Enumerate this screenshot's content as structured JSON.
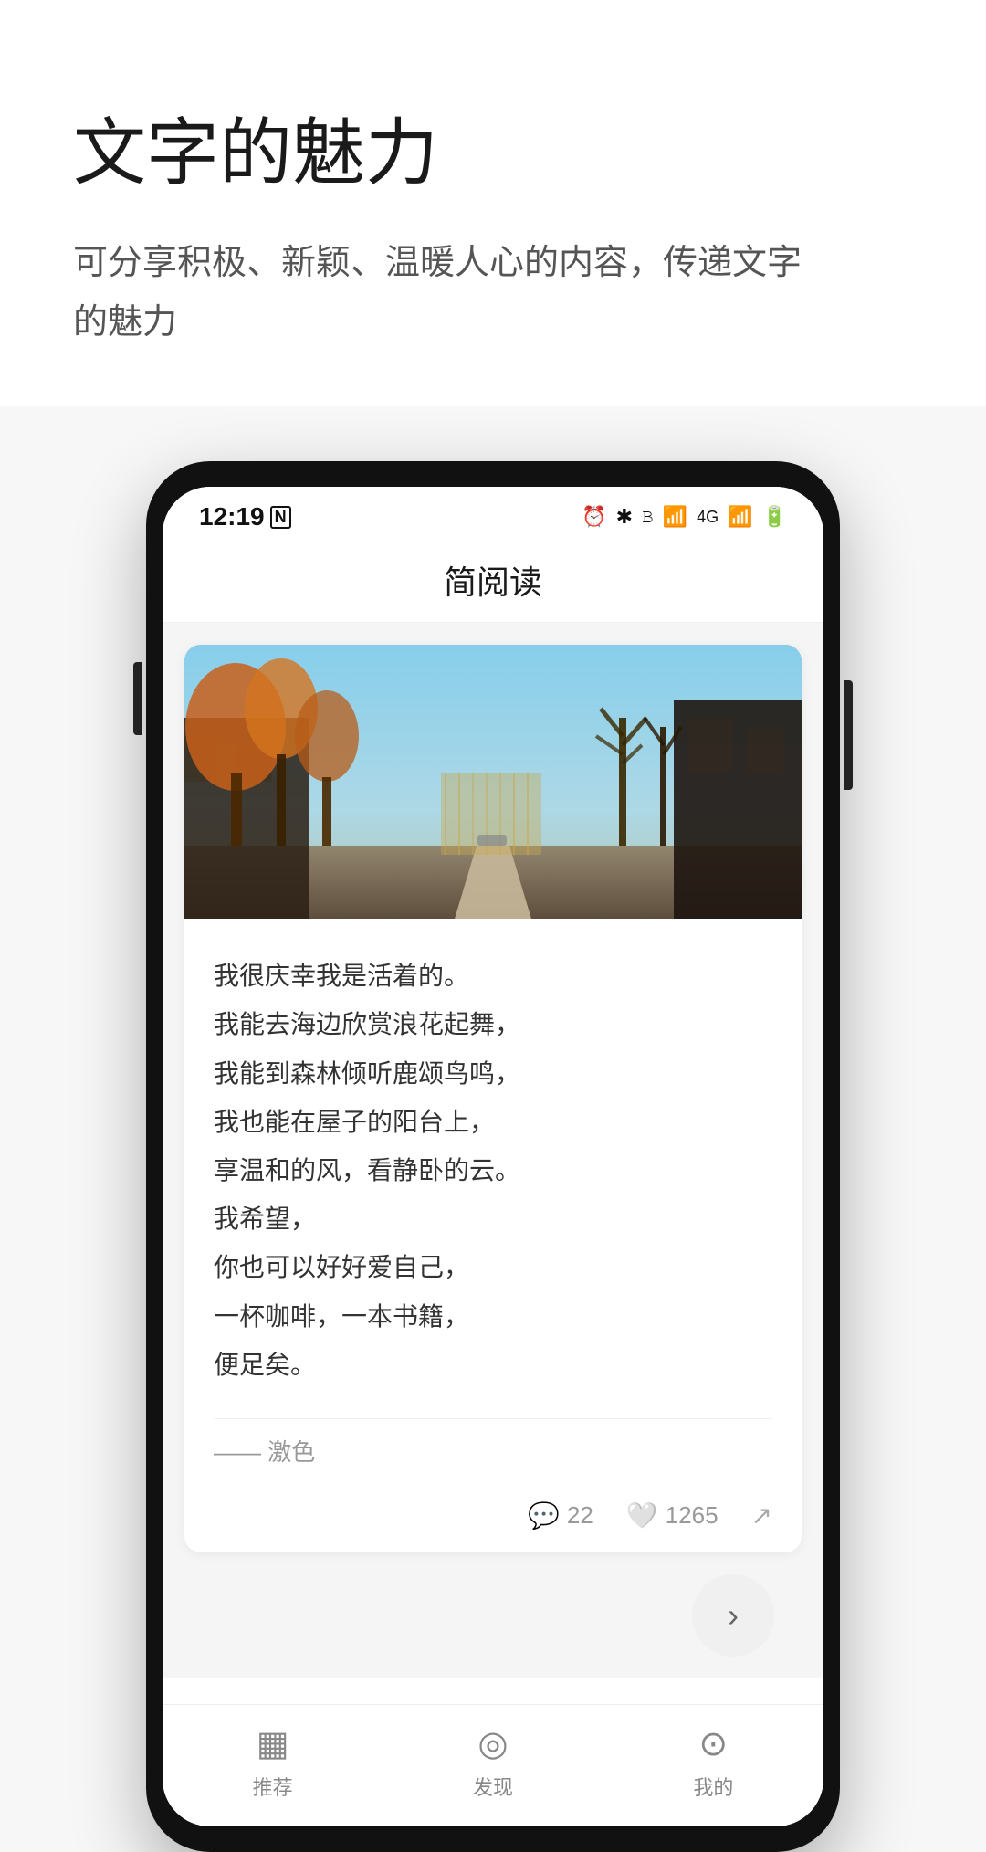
{
  "hero": {
    "title": "文字的魅力",
    "subtitle": "可分享积极、新颖、温暖人心的内容，传递文字的魅力"
  },
  "phone": {
    "status": {
      "time": "12:19",
      "nfc_icon": "N",
      "icons": "⏰ ✱ 𝓑 ≋ 📶 📶 🔋"
    },
    "app_title": "简阅读",
    "article": {
      "text_lines": [
        "我很庆幸我是活着的。",
        "我能去海边欣赏浪花起舞，",
        "我能到森林倾听鹿颂鸟鸣，",
        "我也能在屋子的阳台上，",
        "享温和的风，看静卧的云。",
        "我希望，",
        "你也可以好好爱自己，",
        "一杯咖啡，一本书籍，",
        "便足矣。"
      ],
      "author": "—— 激色",
      "comments": "22",
      "likes": "1265"
    },
    "nav": {
      "items": [
        {
          "icon": "📺",
          "label": "推荐"
        },
        {
          "icon": "🧭",
          "label": "发现"
        },
        {
          "icon": "👤",
          "label": "我的"
        }
      ]
    }
  }
}
